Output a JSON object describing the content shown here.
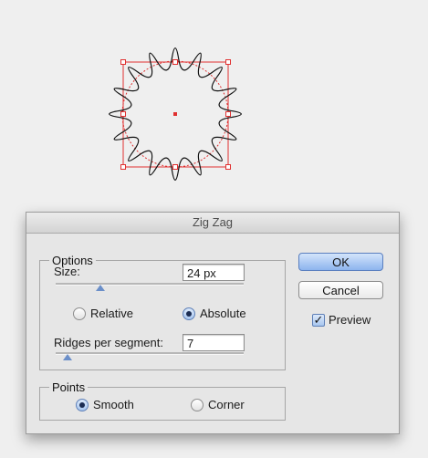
{
  "dialog": {
    "title": "Zig Zag",
    "options": {
      "legend": "Options",
      "size_label": "Size:",
      "size_value": "24 px",
      "relative_label": "Relative",
      "absolute_label": "Absolute",
      "mode_selected": "Absolute",
      "ridges_label": "Ridges per segment:",
      "ridges_value": "7"
    },
    "points": {
      "legend": "Points",
      "smooth_label": "Smooth",
      "corner_label": "Corner",
      "selected": "Smooth"
    },
    "ok_label": "OK",
    "cancel_label": "Cancel",
    "preview_label": "Preview",
    "preview_checked": true,
    "check_glyph": "✓"
  },
  "colors": {
    "selection": "#e03030",
    "path": "#111111",
    "accent": "#6b8fc9"
  }
}
